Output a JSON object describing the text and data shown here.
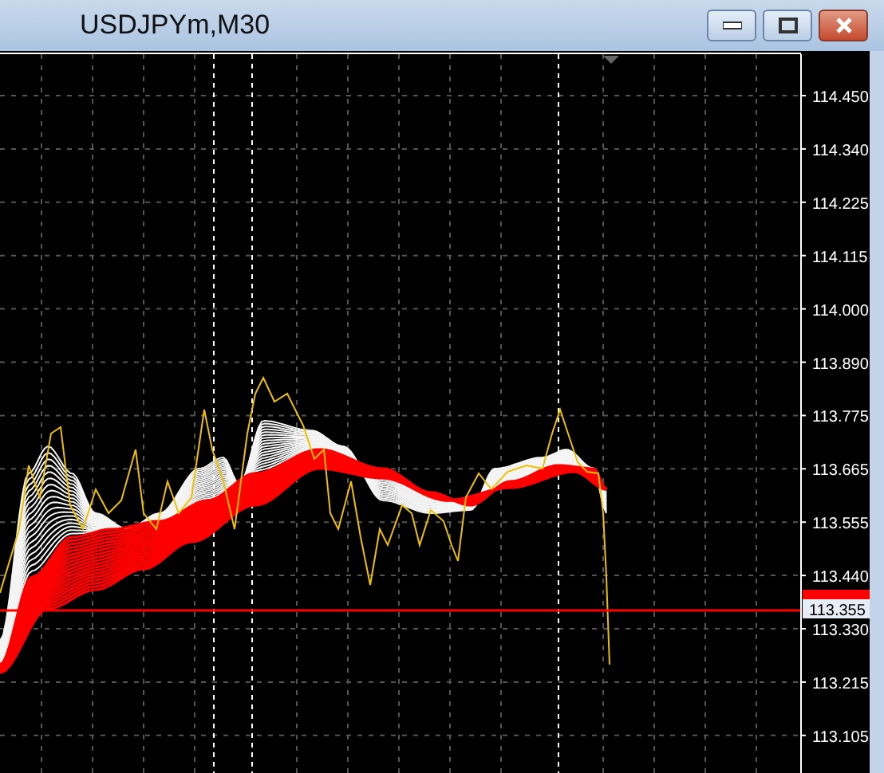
{
  "window": {
    "title": "USDJPYm,M30"
  },
  "price_axis": {
    "labels": [
      "114.450",
      "114.340",
      "114.225",
      "114.115",
      "114.000",
      "113.890",
      "113.775",
      "113.665",
      "113.555",
      "113.440",
      "113.330",
      "113.215",
      "113.105"
    ],
    "current_price": "113.355"
  }
}
